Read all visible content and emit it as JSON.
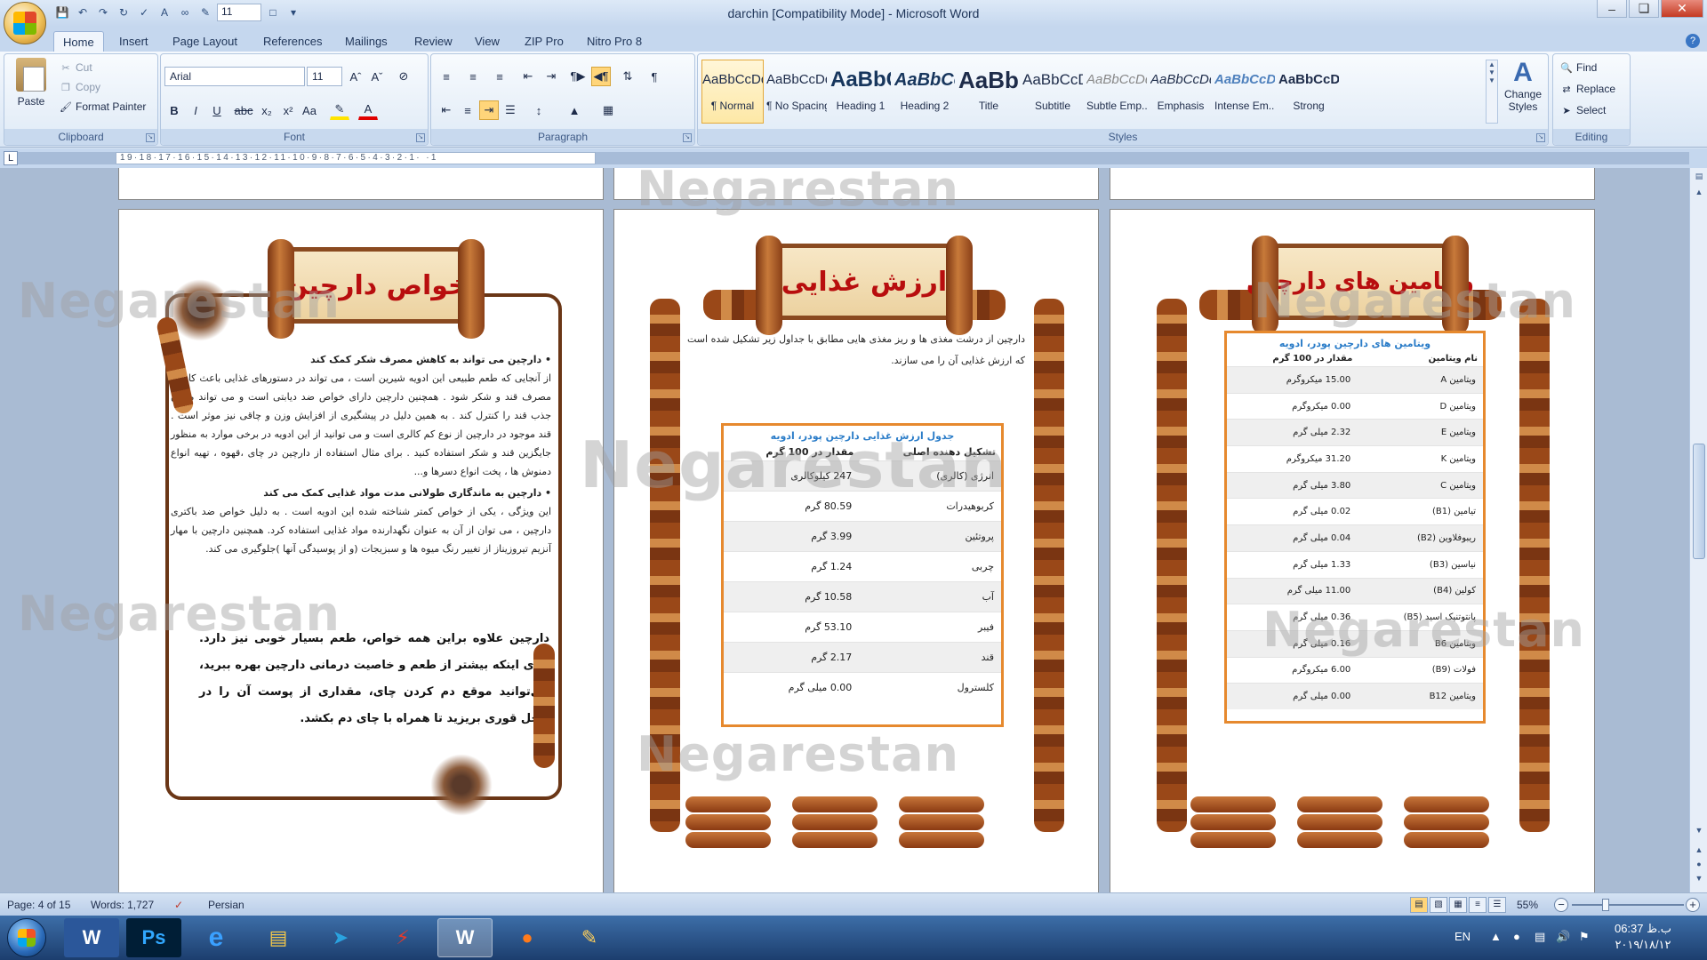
{
  "window": {
    "title": "darchin [Compatibility Mode] - Microsoft Word",
    "font_size_qat": "11",
    "controls": [
      "–",
      "❏",
      "✕"
    ]
  },
  "tabs": [
    "Home",
    "Insert",
    "Page Layout",
    "References",
    "Mailings",
    "Review",
    "View",
    "ZIP Pro",
    "Nitro Pro 8"
  ],
  "ribbon": {
    "clipboard": {
      "label": "Clipboard",
      "paste": "Paste",
      "cut": "Cut",
      "copy": "Copy",
      "format_painter": "Format Painter"
    },
    "font": {
      "label": "Font",
      "family": "Arial",
      "size": "11"
    },
    "paragraph": {
      "label": "Paragraph"
    },
    "styles": {
      "label": "Styles",
      "items": [
        {
          "preview": "AaBbCcDd",
          "name": "¶ Normal"
        },
        {
          "preview": "AaBbCcDd",
          "name": "¶ No Spacing"
        },
        {
          "preview": "AaBbC",
          "name": "Heading 1"
        },
        {
          "preview": "AaBbCc",
          "name": "Heading 2"
        },
        {
          "preview": "AaBbC",
          "name": "Title"
        },
        {
          "preview": "AaBbCcD",
          "name": "Subtitle"
        },
        {
          "preview": "AaBbCcDd",
          "name": "Subtle Emp..."
        },
        {
          "preview": "AaBbCcDd",
          "name": "Emphasis"
        },
        {
          "preview": "AaBbCcDd",
          "name": "Intense Em..."
        },
        {
          "preview": "AaBbCcDc",
          "name": "Strong"
        }
      ],
      "change_styles_1": "Change",
      "change_styles_2": "Styles"
    },
    "editing": {
      "label": "Editing",
      "find": "Find",
      "replace": "Replace",
      "select": "Select"
    }
  },
  "ruler": {
    "numbers": "19·18·17·16·15·14·13·12·11·10·9·8·7·6·5·4·3·2·1·  ·1"
  },
  "watermark": "Negarestan",
  "page1": {
    "title": "خواص دارچین",
    "heading1": "•  دارچین می تواند به کاهش مصرف شکر کمک کند",
    "para1": "از آنجایی که طعم طبیعی این ادویه شیرین است ، می تواند در دستورهای غذایی باعث کاهش مصرف قند و شکر شود . همچنین دارچین دارای خواص ضد دیابتی است و می تواند میزان جذب قند را کنترل کند . به همین دلیل در پیشگیری از افزایش وزن و چاقی نیز موثر است . قند موجود در دارچین از نوع کم کالری است و می توانید از این ادویه در برخی موارد به منظور جایگزین قند و شکر استفاده کنید . برای مثال استفاده از دارچین در چای ،قهوه ، تهیه انواع دمنوش ها ، پخت انواع دسرها و...",
    "heading2": "•  دارچین به ماندگاری طولانی مدت مواد غذایی کمک می کند",
    "para2": "این ویژگی ، یکی از خواص کمتر شناخته شده این ادویه است . به دلیل خواص ضد باکتری دارچین ، می توان از آن به عنوان نگهدارنده مواد غذایی استفاده کرد. همچنین دارچین با مهار آنزیم تیروزیناز از تغییر رنگ میوه ها و سبزیجات (و از پوسیدگی آنها )جلوگیری می کند.",
    "closing": "دارچین علاوه براین همه خواص، طعم بسیار خوبی نیز دارد. برای اینکه بیشتر از طعم و خاصیت درمانی دارچین بهره ببرید، می‌توانید موقع دم کردن چای، مقداری از پوست آن را در داخل قوری بریزید تا همراه با چای دم بکشد."
  },
  "page2": {
    "title": "ارزش غذایی",
    "intro": "دارچین از درشت مغذی ها و ریز مغذی هایی مطابق با جداول زیر تشکیل شده است که ارزش غذایی آن را می سازند.",
    "table_caption": "جدول ارزش غذایی دارچین پودر، ادویه",
    "col1": "تشکیل دهنده اصلی",
    "col2": "مقدار در 100 گرم",
    "rows": [
      {
        "name": "انرژی (کالری)",
        "value": "247 کیلوکالری"
      },
      {
        "name": "کربوهیدرات",
        "value": "80.59 گرم"
      },
      {
        "name": "پروتئین",
        "value": "3.99 گرم"
      },
      {
        "name": "چربی",
        "value": "1.24 گرم"
      },
      {
        "name": "آب",
        "value": "10.58 گرم"
      },
      {
        "name": "فیبر",
        "value": "53.10 گرم"
      },
      {
        "name": "قند",
        "value": "2.17 گرم"
      },
      {
        "name": "کلسترول",
        "value": "0.00 میلی گرم"
      }
    ]
  },
  "page3": {
    "title": "ویتامین های دارچین",
    "table_caption": "ویتامین های دارچین پودر، ادویه",
    "col1": "نام ویتامین",
    "col2": "مقدار در 100 گرم",
    "rows": [
      {
        "name": "ویتامین A",
        "value": "15.00 میکروگرم"
      },
      {
        "name": "ویتامین D",
        "value": "0.00 میکروگرم"
      },
      {
        "name": "ویتامین E",
        "value": "2.32 میلی گرم"
      },
      {
        "name": "ویتامین K",
        "value": "31.20 میکروگرم"
      },
      {
        "name": "ویتامین C",
        "value": "3.80 میلی گرم"
      },
      {
        "name": "تیامین (B1)",
        "value": "0.02 میلی گرم"
      },
      {
        "name": "ریبوفلاوین (B2)",
        "value": "0.04 میلی گرم"
      },
      {
        "name": "نیاسین (B3)",
        "value": "1.33 میلی گرم"
      },
      {
        "name": "کولین (B4)",
        "value": "11.00 میلی گرم"
      },
      {
        "name": "پانتوتنیک اسید (B5)",
        "value": "0.36 میلی گرم"
      },
      {
        "name": "ویتامین B6",
        "value": "0.16 میلی گرم"
      },
      {
        "name": "فولات (B9)",
        "value": "6.00 میکروگرم"
      },
      {
        "name": "ویتامین B12",
        "value": "0.00 میلی گرم"
      }
    ]
  },
  "status": {
    "page": "Page: 4 of 15",
    "words": "Words: 1,727",
    "language": "Persian",
    "zoom": "55%"
  },
  "taskbar": {
    "apps": [
      "W",
      "Ps",
      "e",
      "▤",
      "➤",
      "⚡",
      "W",
      "●",
      "✎"
    ],
    "lang": "EN",
    "time": "06:37 ب.ظ",
    "date": "۲۰۱۹/۱۸/۱۲"
  },
  "colors": {
    "accent": "#2b579a",
    "title_red": "#b80e0e",
    "table_border": "#e6892e",
    "caption_blue": "#2a7cc8"
  }
}
